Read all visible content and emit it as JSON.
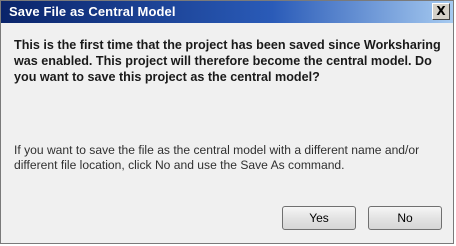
{
  "dialog": {
    "title": "Save File as Central Model",
    "close_label": "X",
    "main_instruction": "This is the first time that the project has been saved since Worksharing was enabled. This project will therefore become the central model. Do you want to save this project as the central model?",
    "secondary_text": "If you want to save the file as the central model with a different name and/or different file location, click No and use the Save As command.",
    "buttons": {
      "yes_label": "Yes",
      "no_label": "No"
    }
  }
}
